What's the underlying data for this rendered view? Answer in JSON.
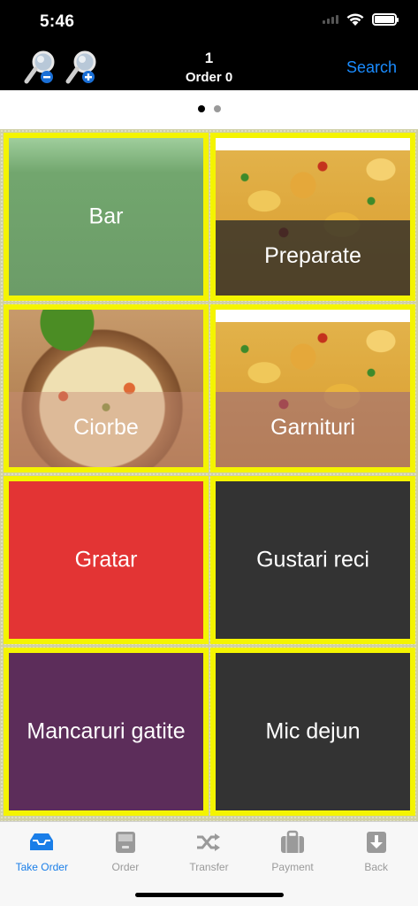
{
  "status_bar": {
    "time": "5:46"
  },
  "nav": {
    "zoom_out_icon": "magnifier-minus-icon",
    "zoom_in_icon": "magnifier-plus-icon",
    "count": "1",
    "order_label": "Order 0",
    "search_label": "Search"
  },
  "pager": {
    "pages": 2,
    "current": 1
  },
  "tiles": [
    {
      "label": "Bar",
      "style": "green"
    },
    {
      "label": "Preparate",
      "style": "potato-image"
    },
    {
      "label": "Ciorbe",
      "style": "soup-image"
    },
    {
      "label": "Garnituri",
      "style": "potato-image"
    },
    {
      "label": "Gratar",
      "style": "red",
      "color": "#e33434"
    },
    {
      "label": "Gustari reci",
      "style": "dark",
      "color": "#333333"
    },
    {
      "label": "Mancaruri gatite",
      "style": "purple",
      "color": "#5c2d5a"
    },
    {
      "label": "Mic dejun",
      "style": "dark",
      "color": "#333333"
    }
  ],
  "tabbar": {
    "tabs": [
      {
        "label": "Take Order",
        "icon": "inbox-tray-icon",
        "active": true
      },
      {
        "label": "Order",
        "icon": "archive-drawer-icon",
        "active": false
      },
      {
        "label": "Transfer",
        "icon": "shuffle-icon",
        "active": false
      },
      {
        "label": "Payment",
        "icon": "briefcase-icon",
        "active": false
      },
      {
        "label": "Back",
        "icon": "download-arrow-icon",
        "active": false
      }
    ]
  },
  "colors": {
    "accent": "#1a8cff",
    "tile_border": "#f4f400",
    "tab_active": "#1a7ee8",
    "tab_inactive": "#9a9a9a"
  }
}
